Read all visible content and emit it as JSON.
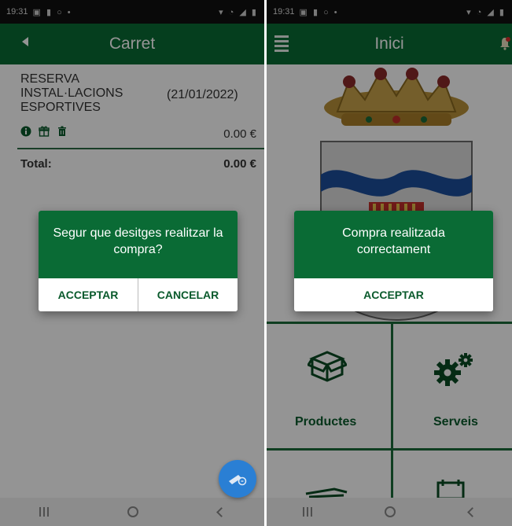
{
  "colors": {
    "app_green": "#0a6b35",
    "fab_blue": "#2a7fd4",
    "text_dark": "#333333"
  },
  "left_screen": {
    "status_bar": {
      "time": "19:31"
    },
    "app_bar": {
      "title": "Carret",
      "back_icon": "back-arrow-icon"
    },
    "cart_item": {
      "name": "RESERVA INSTAL·LACIONS ESPORTIVES",
      "date": "(21/01/2022)",
      "price": "0.00 €",
      "icons": [
        "info-icon",
        "gift-box-icon",
        "trash-icon"
      ]
    },
    "total": {
      "label": "Total:",
      "value": "0.00 €"
    },
    "fab_icon": "payment-icon",
    "dialog": {
      "message": "Segur que desitges realitzar la compra?",
      "accept_label": "ACCEPTAR",
      "cancel_label": "CANCELAR"
    }
  },
  "right_screen": {
    "status_bar": {
      "time": "19:31"
    },
    "app_bar": {
      "title": "Inici",
      "menu_icon": "menu-icon",
      "notification_icon": "bell-icon"
    },
    "crest_icon": "coat-of-arms-icon",
    "tiles": [
      {
        "label": "Productes",
        "icon": "box-icon"
      },
      {
        "label": "Serveis",
        "icon": "gears-icon"
      }
    ],
    "dialog": {
      "message": "Compra realitzada correctament",
      "accept_label": "ACCEPTAR"
    }
  }
}
